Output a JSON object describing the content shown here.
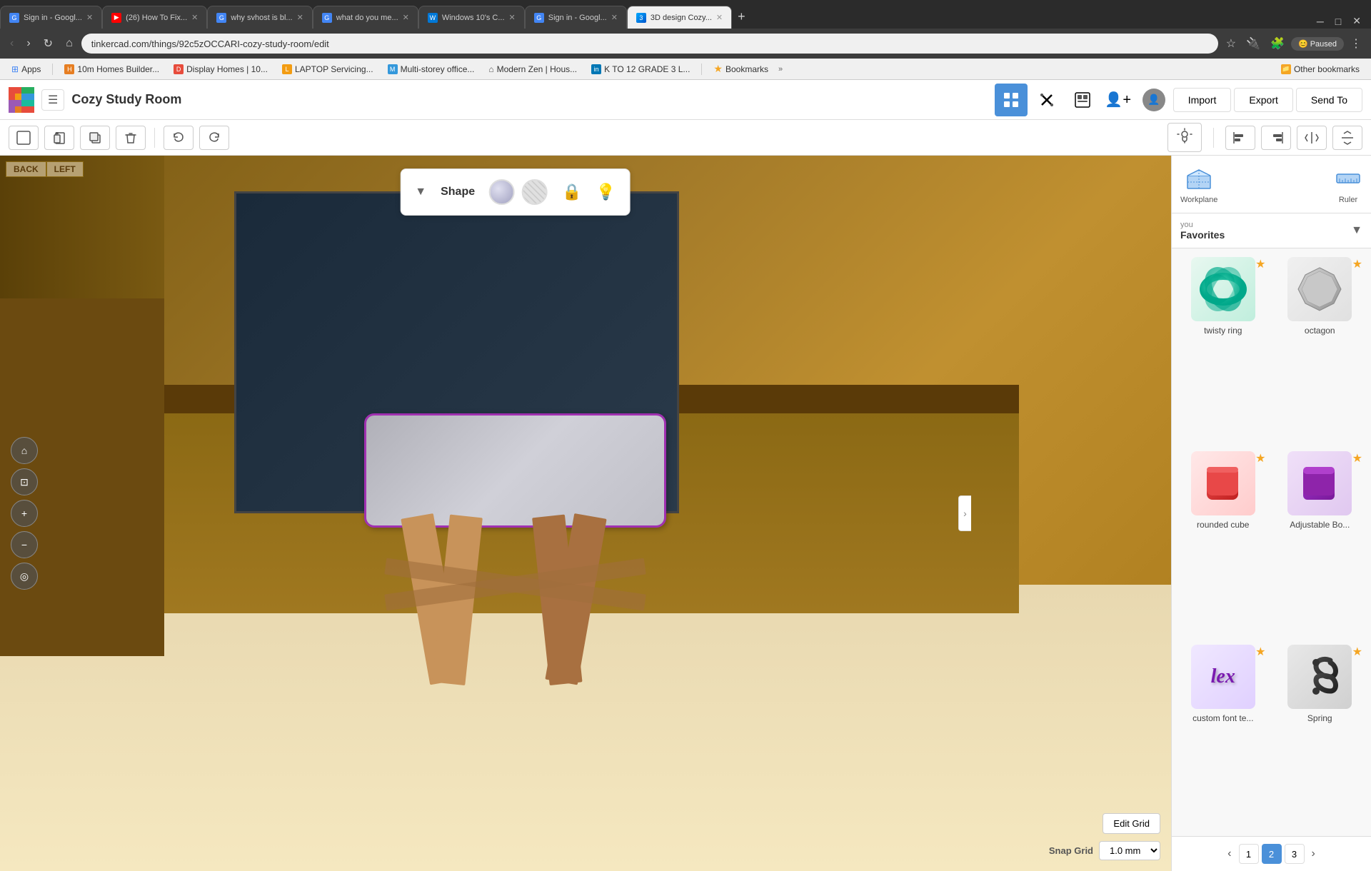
{
  "browser": {
    "tabs": [
      {
        "id": "t1",
        "favicon_color": "#4285f4",
        "favicon_letter": "G",
        "title": "Sign in - Googl...",
        "active": false
      },
      {
        "id": "t2",
        "favicon_color": "#ff0000",
        "favicon_letter": "▶",
        "title": "(26) How To Fix...",
        "active": false
      },
      {
        "id": "t3",
        "favicon_color": "#4285f4",
        "favicon_letter": "G",
        "title": "why svhost is bl...",
        "active": false
      },
      {
        "id": "t4",
        "favicon_color": "#4285f4",
        "favicon_letter": "G",
        "title": "what do you me...",
        "active": false
      },
      {
        "id": "t5",
        "favicon_color": "#0078d7",
        "favicon_letter": "W",
        "title": "Windows 10's C...",
        "active": false
      },
      {
        "id": "t6",
        "favicon_color": "#4285f4",
        "favicon_letter": "G",
        "title": "Sign in - Googl...",
        "active": false
      },
      {
        "id": "t7",
        "favicon_color": "#00aaff",
        "favicon_letter": "3",
        "title": "3D design Cozy...",
        "active": true
      }
    ],
    "address": "tinkercad.com/things/92c5zOCCARI-cozy-study-room/edit",
    "bookmarks": [
      {
        "label": "Apps",
        "color": "#4285f4"
      },
      {
        "label": "10m Homes Builder...",
        "color": "#e67e22"
      },
      {
        "label": "Display Homes | 10...",
        "color": "#e74c3c"
      },
      {
        "label": "LAPTOP Servicing...",
        "color": "#f39c12"
      },
      {
        "label": "Multi-storey office...",
        "color": "#3498db"
      },
      {
        "label": "Modern Zen | Hous...",
        "color": "#555"
      },
      {
        "label": "K TO 12 GRADE 3 L...",
        "color": "#0077b5"
      },
      {
        "label": "Bookmarks",
        "color": "#f5a623"
      }
    ],
    "other_bookmarks": "Other bookmarks"
  },
  "header": {
    "logo": {
      "colors": [
        "#e74c3c",
        "#f39c12",
        "#27ae60",
        "#3498db",
        "#9b59b6",
        "#e67e22",
        "#1abc9c",
        "#e74c3c"
      ]
    },
    "title": "Cozy Study Room",
    "import_label": "Import",
    "export_label": "Export",
    "send_to_label": "Send To"
  },
  "toolbar": {
    "tools": [
      {
        "name": "new-shape",
        "icon": "☐",
        "label": "New shape"
      },
      {
        "name": "paste",
        "icon": "📋",
        "label": "Paste"
      },
      {
        "name": "duplicate",
        "icon": "⧉",
        "label": "Duplicate"
      },
      {
        "name": "delete",
        "icon": "🗑",
        "label": "Delete"
      },
      {
        "name": "undo",
        "icon": "↺",
        "label": "Undo"
      },
      {
        "name": "redo",
        "icon": "↻",
        "label": "Redo"
      }
    ],
    "light_icon": "💡",
    "align_icons": [
      "⬜",
      "⬜",
      "⬜",
      "⬜"
    ]
  },
  "shape_panel": {
    "title": "Shape",
    "solid_label": "Solid",
    "hole_label": "Hole"
  },
  "viewport": {
    "view_labels": [
      "BACK",
      "LEFT"
    ],
    "edit_grid": "Edit Grid",
    "snap_grid_label": "Snap Grid",
    "snap_value": "1.0 mm",
    "nav_icons": [
      "⌂",
      "⊡",
      "+",
      "−",
      "◎"
    ]
  },
  "right_panel": {
    "workplane_label": "Workplane",
    "ruler_label": "Ruler",
    "user_label": "you",
    "favorites_label": "Favorites",
    "shapes": [
      {
        "id": "s1",
        "name": "twisty ring",
        "emoji": "🌀",
        "bg": "#00c8a0",
        "starred": true,
        "row": 1,
        "col": 1
      },
      {
        "id": "s2",
        "name": "octagon",
        "emoji": "⬡",
        "bg": "#c0c0c0",
        "starred": true,
        "row": 1,
        "col": 2
      },
      {
        "id": "s3",
        "name": "rounded cube",
        "emoji": "🟥",
        "bg": "#e74c3c",
        "starred": true,
        "row": 2,
        "col": 1
      },
      {
        "id": "s4",
        "name": "Adjustable Bo...",
        "emoji": "🟪",
        "bg": "#8e44ad",
        "starred": true,
        "row": 2,
        "col": 2
      },
      {
        "id": "s5",
        "name": "custom font te...",
        "emoji": "𝕋",
        "bg": "#6a0dad",
        "starred": true,
        "row": 3,
        "col": 1
      },
      {
        "id": "s6",
        "name": "Spring",
        "emoji": "🌀",
        "bg": "#333",
        "starred": true,
        "row": 3,
        "col": 2
      }
    ],
    "pagination": {
      "prev": "‹",
      "next": "›",
      "pages": [
        "1",
        "2",
        "3"
      ],
      "active_page": "2"
    }
  }
}
